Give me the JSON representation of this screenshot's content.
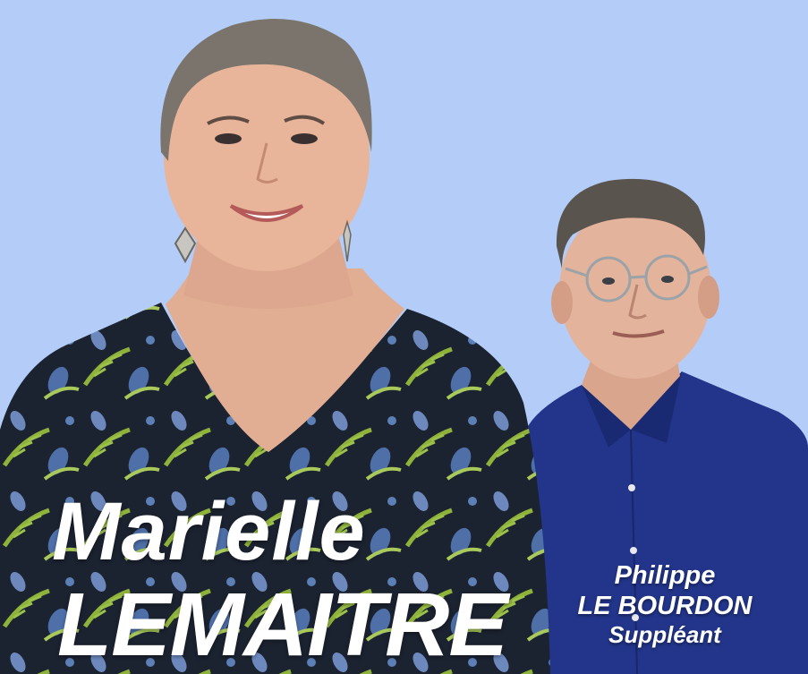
{
  "poster": {
    "background_color": "#b4cdf8",
    "candidate": {
      "first_name": "Marielle",
      "last_name": "LEMAITRE",
      "dress_color": "#1b2230",
      "leaf_color": "#8fb23a",
      "pattern_color": "#4e6fa8"
    },
    "substitute": {
      "first_name": "Philippe",
      "last_name": "LE BOURDON",
      "role": "Suppléant",
      "shirt_color": "#22358a"
    }
  }
}
